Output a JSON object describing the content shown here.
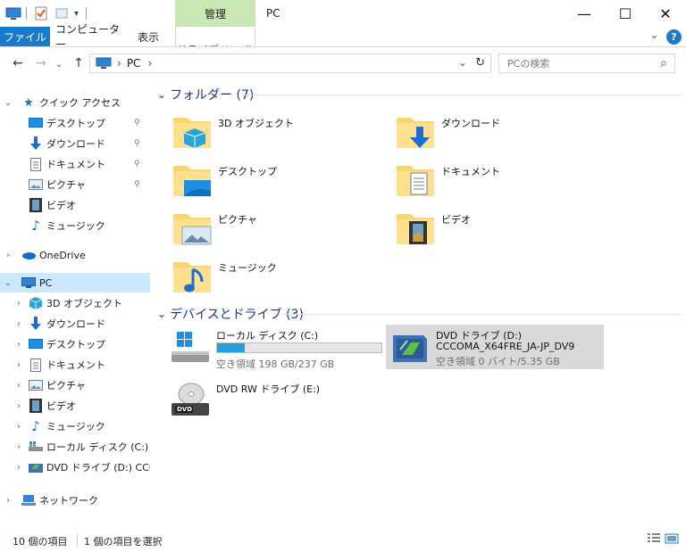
{
  "window": {
    "context_tab": "管理",
    "title": "PC",
    "minimize": "—",
    "maximize": "☐",
    "close": "✕"
  },
  "ribbon": {
    "tabs": [
      "ファイル",
      "コンピューター",
      "表示",
      "ドライブ ツール"
    ],
    "expand_symbol": "⌄",
    "help_symbol": "?"
  },
  "address": {
    "back": "←",
    "forward": "→",
    "recent": "⌄",
    "up": "↑",
    "path": [
      "PC"
    ],
    "separator": "›",
    "dropdown": "⌄",
    "refresh": "↻",
    "search_placeholder": "PCの検索",
    "search_icon": "⌕"
  },
  "nav": {
    "quick_access": {
      "label": "クイック アクセス",
      "items": [
        {
          "label": "デスクトップ",
          "icon": "desktop-icon",
          "pinned": true
        },
        {
          "label": "ダウンロード",
          "icon": "download-icon",
          "pinned": true
        },
        {
          "label": "ドキュメント",
          "icon": "documents-icon",
          "pinned": true
        },
        {
          "label": "ピクチャ",
          "icon": "pictures-icon",
          "pinned": true
        },
        {
          "label": "ビデオ",
          "icon": "videos-icon",
          "pinned": false
        },
        {
          "label": "ミュージック",
          "icon": "music-icon",
          "pinned": false
        }
      ],
      "pin_symbol": "📌"
    },
    "onedrive": "OneDrive",
    "pc": {
      "label": "PC",
      "items": [
        {
          "label": "3D オブジェクト",
          "icon": "3d-objects-icon"
        },
        {
          "label": "ダウンロード",
          "icon": "download-icon"
        },
        {
          "label": "デスクトップ",
          "icon": "desktop-icon"
        },
        {
          "label": "ドキュメント",
          "icon": "documents-icon"
        },
        {
          "label": "ピクチャ",
          "icon": "pictures-icon"
        },
        {
          "label": "ビデオ",
          "icon": "videos-icon"
        },
        {
          "label": "ミュージック",
          "icon": "music-icon"
        },
        {
          "label": "ローカル ディスク (C:)",
          "icon": "local-disk-icon"
        },
        {
          "label": "DVD ドライブ (D:) CCCO",
          "icon": "dvd-drive-icon"
        }
      ]
    },
    "network": "ネットワーク"
  },
  "content": {
    "folders_header": "フォルダー (7)",
    "folders": [
      {
        "label": "3D オブジェクト",
        "icon": "3d-objects-icon"
      },
      {
        "label": "ダウンロード",
        "icon": "download-icon"
      },
      {
        "label": "デスクトップ",
        "icon": "desktop-icon"
      },
      {
        "label": "ドキュメント",
        "icon": "documents-icon"
      },
      {
        "label": "ピクチャ",
        "icon": "pictures-icon"
      },
      {
        "label": "ビデオ",
        "icon": "videos-icon"
      },
      {
        "label": "ミュージック",
        "icon": "music-icon"
      }
    ],
    "drives_header": "デバイスとドライブ (3)",
    "drives": [
      {
        "label": "ローカル ディスク (C:)",
        "sub": "空き領域 198 GB/237 GB",
        "used_fraction": 0.17,
        "icon": "local-disk-icon"
      },
      {
        "label": "DVD ドライブ (D:)",
        "label2": "CCCOMA_X64FRE_JA-JP_DV9",
        "sub": "空き領域 0 バイト/5.35 GB",
        "icon": "dvd-drive-icon",
        "selected": true
      },
      {
        "label": "DVD RW ドライブ (E:)",
        "icon": "dvd-rw-drive-icon"
      }
    ]
  },
  "status": {
    "item_count": "10 個の項目",
    "selected": "1 個の項目を選択"
  },
  "colors": {
    "accent": "#1979ca",
    "context_tab": "#c9e8b4",
    "selected_nav": "#cce8ff",
    "folder": "#f8d574",
    "header_text": "#1e3287"
  }
}
